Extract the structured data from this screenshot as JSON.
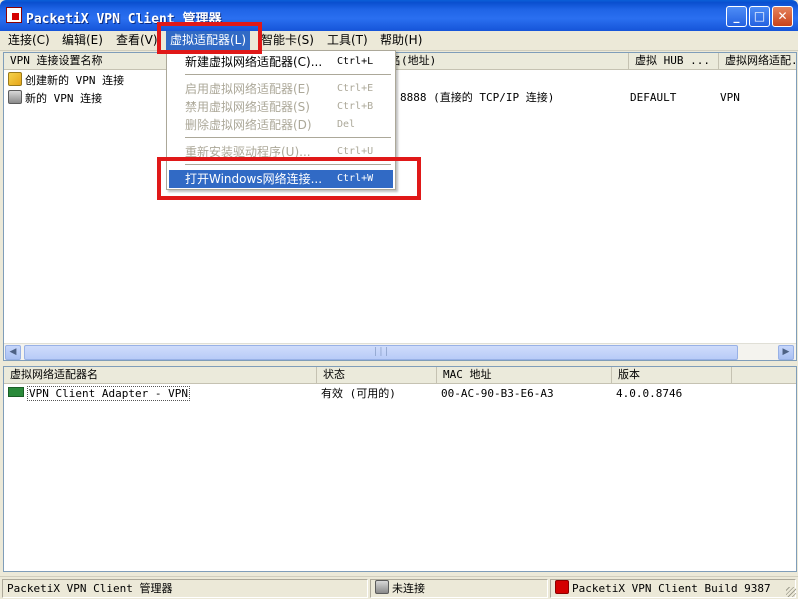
{
  "window": {
    "title": "PacketiX VPN Client 管理器",
    "minimize": "_",
    "maximize": "□",
    "close": "✕"
  },
  "menu": {
    "items": [
      {
        "label": "连接(C)"
      },
      {
        "label": "编辑(E)"
      },
      {
        "label": "查看(V)"
      },
      {
        "label": "虚拟适配器(L)"
      },
      {
        "label": "智能卡(S)"
      },
      {
        "label": "工具(T)"
      },
      {
        "label": "帮助(H)"
      }
    ]
  },
  "dropdown": {
    "items": [
      {
        "label": "新建虚拟网络适配器(C)...",
        "shortcut": "Ctrl+L",
        "enabled": true
      },
      {
        "label": "启用虚拟网络适配器(E)",
        "shortcut": "Ctrl+E",
        "enabled": false
      },
      {
        "label": "禁用虚拟网络适配器(S)",
        "shortcut": "Ctrl+B",
        "enabled": false
      },
      {
        "label": "删除虚拟网络适配器(D)",
        "shortcut": "Del",
        "enabled": false
      },
      {
        "label": "重新安装驱动程序(U)...",
        "shortcut": "Ctrl+U",
        "enabled": false
      },
      {
        "label": "打开Windows网络连接...",
        "shortcut": "Ctrl+W",
        "enabled": true,
        "highlighted": true
      }
    ]
  },
  "vpn_list": {
    "columns": [
      "VPN 连接设置名称",
      "名(地址)",
      "虚拟 HUB ...",
      "虚拟网络适配..."
    ],
    "rows": [
      {
        "name": "创建新的 VPN 连接",
        "address": "",
        "hub": "",
        "adapter": ""
      },
      {
        "name": "新的 VPN 连接",
        "address": "8888 (直接的 TCP/IP 连接)",
        "hub": "DEFAULT",
        "adapter": "VPN"
      }
    ]
  },
  "adapter_list": {
    "columns": [
      "虚拟网络适配器名",
      "状态",
      "MAC 地址",
      "版本"
    ],
    "rows": [
      {
        "name": "VPN Client Adapter - VPN",
        "status": "有效 (可用的)",
        "mac": "00-AC-90-B3-E6-A3",
        "version": "4.0.0.8746"
      }
    ]
  },
  "statusbar": {
    "app": "PacketiX VPN Client 管理器",
    "connection": "未连接",
    "build": "PacketiX VPN Client Build 9387"
  },
  "colors": {
    "titlebar": "#1f64e6",
    "menu_highlight": "#316ac5",
    "annotation_red": "#e01818"
  }
}
